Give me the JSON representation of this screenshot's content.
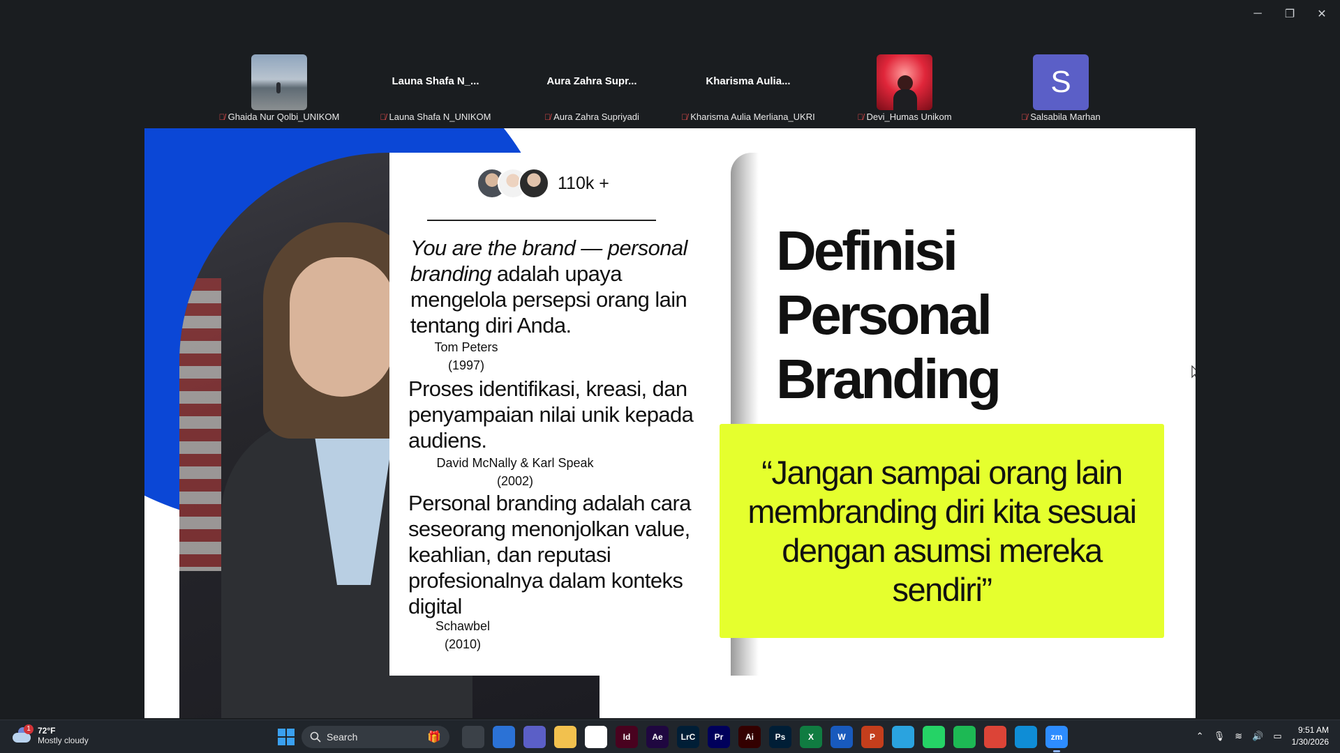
{
  "window": {
    "minimize": "─",
    "restore": "❐",
    "close": "✕"
  },
  "participants": [
    {
      "display": "",
      "label": "Ghaida Nur Qolbi_UNIKOM",
      "thumb": "photo-beach"
    },
    {
      "display": "Launa Shafa N_...",
      "label": "Launa Shafa N_UNIKOM",
      "thumb": ""
    },
    {
      "display": "Aura Zahra Supr...",
      "label": "Aura Zahra Supriyadi",
      "thumb": ""
    },
    {
      "display": "Kharisma Aulia...",
      "label": "Kharisma Aulia Merliana_UKRI",
      "thumb": ""
    },
    {
      "display": "",
      "label": "Devi_Humas Unikom",
      "thumb": "photo-red"
    },
    {
      "display": "S",
      "label": "Salsabila Marhan",
      "thumb": "initial"
    }
  ],
  "slide": {
    "follower_count": "110k +",
    "quote1_italic": "You are the brand — personal branding",
    "quote1_rest": " adalah upaya mengelola persepsi orang lain tentang diri Anda.",
    "quote1_author": "Tom Peters",
    "quote1_year": "(1997)",
    "quote2": "Proses identifikasi, kreasi, dan penyampaian nilai unik kepada audiens.",
    "quote2_author": "David McNally & Karl Speak",
    "quote2_year": "(2002)",
    "quote3": "Personal branding adalah cara seseorang menonjolkan value, keahlian, dan reputasi profesionalnya dalam konteks digital",
    "quote3_author": "Schawbel",
    "quote3_year": "(2010)",
    "title_line1": "Definisi",
    "title_line2": "Personal",
    "title_line3": "Branding",
    "highlight_quote": "“Jangan sampai orang lain membranding diri kita sesuai dengan asumsi mereka sendiri”",
    "accent_blue": "#0b47d6",
    "accent_lime": "#e5ff2e"
  },
  "taskbar": {
    "weather_badge": "1",
    "temperature": "72°F",
    "condition": "Mostly cloudy",
    "search_label": "Search",
    "apps": [
      {
        "name": "task-view",
        "glyph": "",
        "bg": "#3b4148"
      },
      {
        "name": "microsoft-store",
        "glyph": "",
        "bg": "#2b72d6"
      },
      {
        "name": "teams",
        "glyph": "",
        "bg": "#5b5fc7"
      },
      {
        "name": "file-explorer",
        "glyph": "",
        "bg": "#f2c14e"
      },
      {
        "name": "capcut",
        "glyph": "",
        "bg": "#ffffff"
      },
      {
        "name": "indesign",
        "glyph": "Id",
        "bg": "#49021f"
      },
      {
        "name": "after-effects",
        "glyph": "Ae",
        "bg": "#1f0740"
      },
      {
        "name": "lightroom-classic",
        "glyph": "LrC",
        "bg": "#001e36"
      },
      {
        "name": "premiere-pro",
        "glyph": "Pr",
        "bg": "#00005b"
      },
      {
        "name": "illustrator",
        "glyph": "Ai",
        "bg": "#330000"
      },
      {
        "name": "photoshop",
        "glyph": "Ps",
        "bg": "#001e36"
      },
      {
        "name": "excel",
        "glyph": "X",
        "bg": "#107c41"
      },
      {
        "name": "word",
        "glyph": "W",
        "bg": "#185abd"
      },
      {
        "name": "powerpoint",
        "glyph": "P",
        "bg": "#c43e1c"
      },
      {
        "name": "telegram",
        "glyph": "",
        "bg": "#2aa3df"
      },
      {
        "name": "whatsapp",
        "glyph": "",
        "bg": "#25d366"
      },
      {
        "name": "spotify",
        "glyph": "",
        "bg": "#1db954"
      },
      {
        "name": "chrome",
        "glyph": "",
        "bg": "#dc4437"
      },
      {
        "name": "edge",
        "glyph": "",
        "bg": "#0f8dd6"
      },
      {
        "name": "zoom",
        "glyph": "zm",
        "bg": "#2d8cff"
      }
    ],
    "time": "9:51 AM",
    "date": "1/30/2026"
  }
}
